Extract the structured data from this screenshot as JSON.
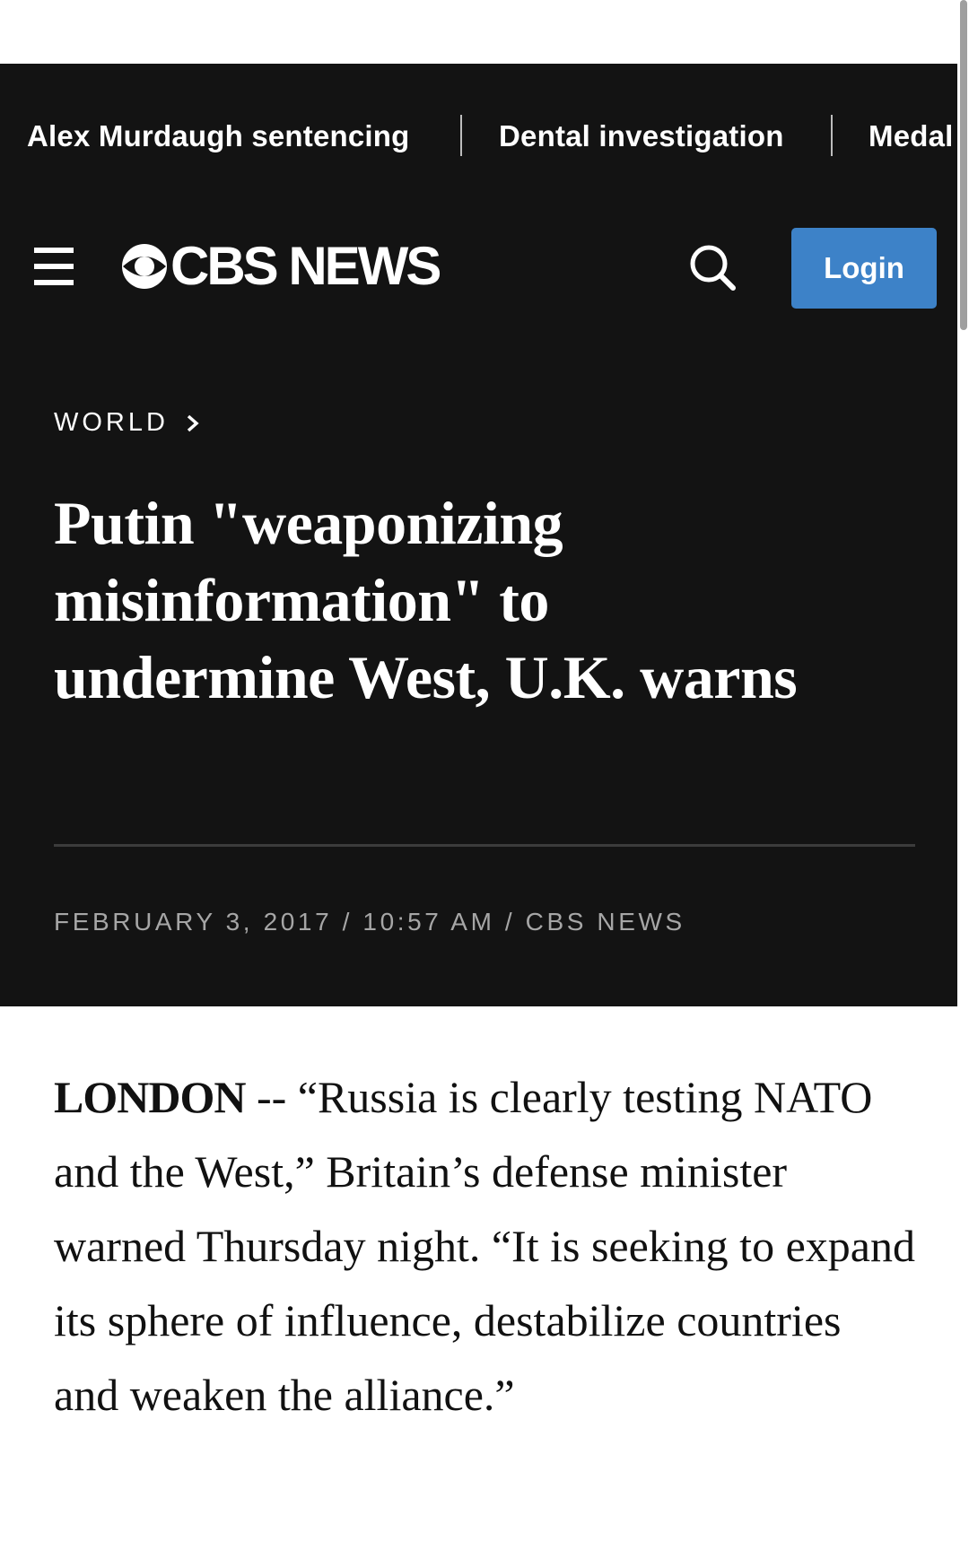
{
  "trending": {
    "items": [
      {
        "label": "Alex Murdaugh sentencing"
      },
      {
        "label": "Dental investigation"
      },
      {
        "label": "Medal"
      }
    ]
  },
  "header": {
    "logo_text": "CBS NEWS",
    "login_label": "Login",
    "icons": [
      "menu-icon",
      "cbs-eye-icon",
      "search-icon"
    ]
  },
  "article": {
    "section": "WORLD",
    "headline": "Putin \"weaponizing misinformation\" to undermine West, U.K. warns",
    "byline": "FEBRUARY 3, 2017 / 10:57 AM / CBS NEWS",
    "dateline": "LONDON",
    "body_intro": " -- “Russia is clearly testing NATO and the West,” Britain’s defense minister warned Thursday night. “It is seeking to expand its sphere of influence, destabilize countries and weaken the alliance.”"
  },
  "colors": {
    "header_bg": "#131313",
    "login_bg": "#3d82c8",
    "byline": "#a6a6a6"
  }
}
